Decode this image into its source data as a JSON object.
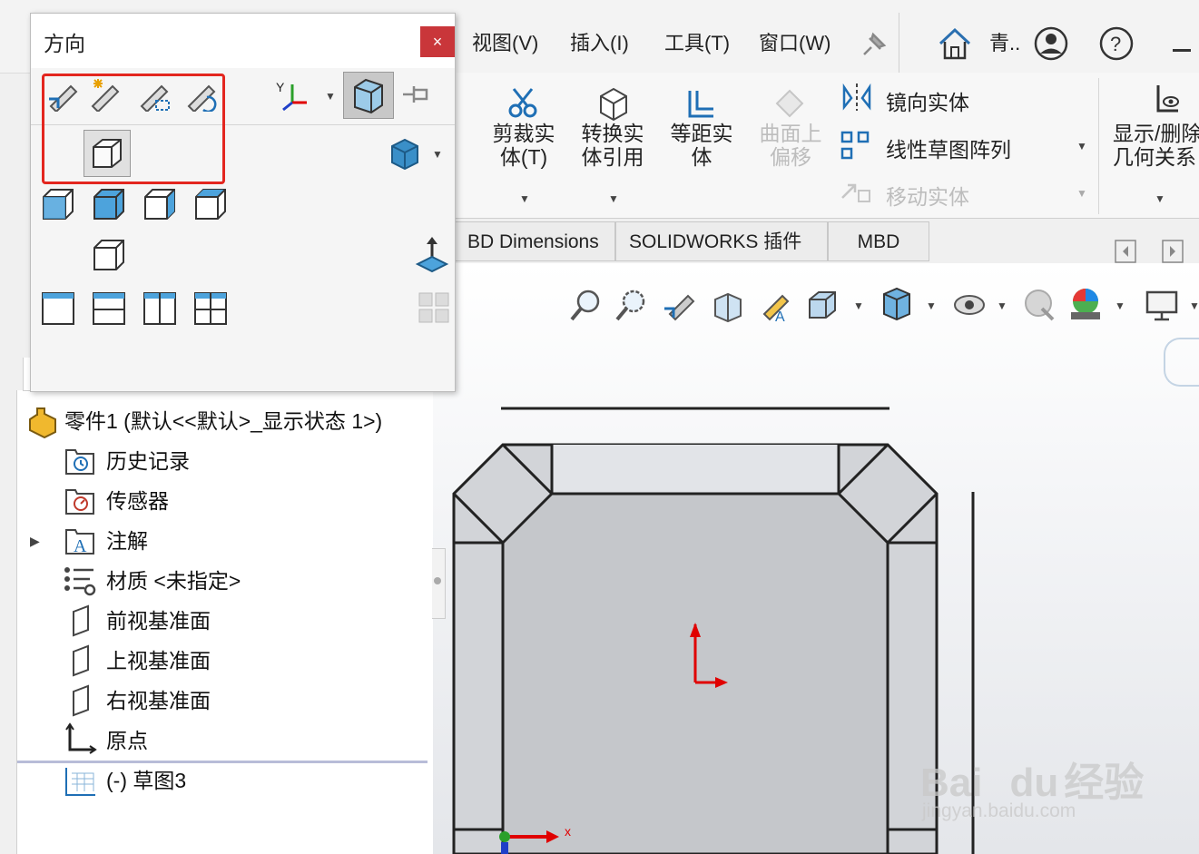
{
  "menubar": {
    "items": [
      "视图(V)",
      "插入(I)",
      "工具(T)",
      "窗口(W)"
    ],
    "user_label": "青.."
  },
  "ribbon": {
    "trim_label": "剪裁实体(T)",
    "convert_label": "转换实体引用",
    "offset_label": "等距实体",
    "surface_offset_label": "曲面上偏移",
    "mirror_label": "镜向实体",
    "linear_pattern_label": "线性草图阵列",
    "move_label": "移动实体",
    "display_relations_label": "显示/删除几何关系"
  },
  "tabs": [
    "BD Dimensions",
    "SOLIDWORKS 插件",
    "MBD"
  ],
  "popup": {
    "title": "方向",
    "close": "×"
  },
  "tree": {
    "root": "零件1 (默认<<默认>_显示状态 1>)",
    "items": [
      "历史记录",
      "传感器",
      "注解",
      "材质 <未指定>",
      "前视基准面",
      "上视基准面",
      "右视基准面",
      "原点",
      "(-) 草图3"
    ]
  },
  "graphics": {
    "axis_x_label": "x"
  },
  "watermark": {
    "brand": "Bai",
    "brand2": "du",
    "cn": "经验",
    "url": "jingyan.baidu.com"
  },
  "colors": {
    "highlight": "#e3261f",
    "close_bg": "#c9363a",
    "origin_red": "#e00000",
    "icon_blue": "#3a8fc8"
  }
}
